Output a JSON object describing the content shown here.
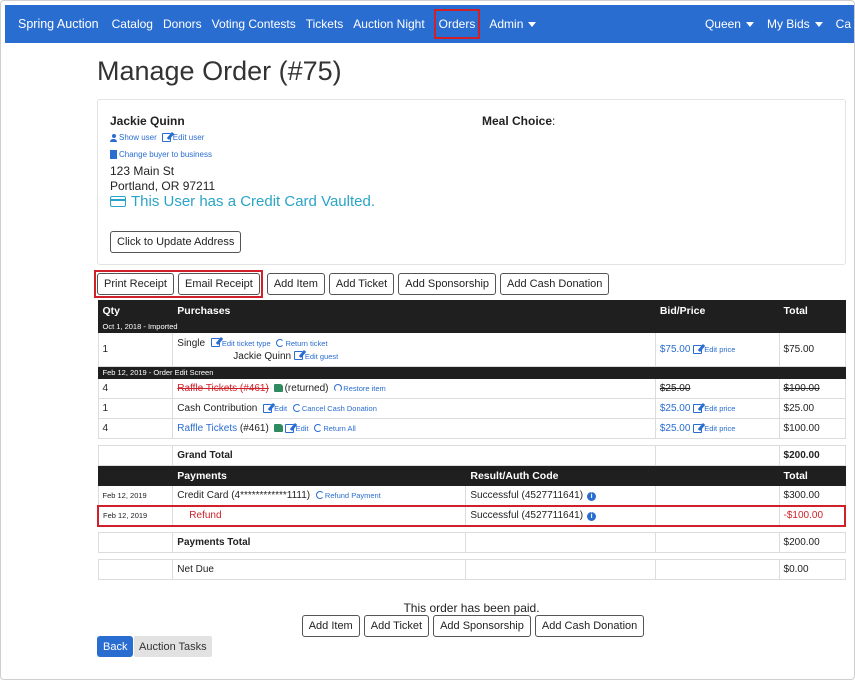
{
  "navbar": {
    "brand": "Spring Auction",
    "items": [
      "Catalog",
      "Donors",
      "Voting Contests",
      "Tickets",
      "Auction Night",
      "Orders",
      "Admin"
    ],
    "right_items": [
      "Queen",
      "My Bids",
      "Ca"
    ]
  },
  "page": {
    "title": "Manage Order (#75)"
  },
  "user": {
    "name": "Jackie Quinn",
    "meal_choice_label": "Meal Choice",
    "show_user": "Show user",
    "edit_user": "Edit user",
    "change_buyer": "Change buyer to business",
    "address_line1": "123 Main St",
    "address_line2": "Portland, OR 97211",
    "credit_card_msg": "This User has a Credit Card Vaulted.",
    "update_address": "Click to Update Address"
  },
  "toolbar": {
    "print_receipt": "Print Receipt",
    "email_receipt": "Email Receipt",
    "add_item": "Add Item",
    "add_ticket": "Add Ticket",
    "add_sponsorship": "Add Sponsorship",
    "add_cash_donation": "Add Cash Donation"
  },
  "table": {
    "headers": {
      "qty": "Qty",
      "purchases": "Purchases",
      "bid_price": "Bid/Price",
      "total": "Total"
    },
    "groups": [
      {
        "label": "Oct 1, 2018 - Imported",
        "rows": [
          {
            "qty": "1",
            "name": "Single",
            "edit_ticket_type": "Edit ticket type",
            "return_ticket": "Return ticket",
            "guest": "Jackie Quinn",
            "edit_guest": "Edit guest",
            "price": "$75.00",
            "edit_price": "Edit price",
            "total": "$75.00"
          }
        ]
      },
      {
        "label": "Feb 12, 2019 - Order Edit Screen",
        "rows": [
          {
            "qty": "4",
            "name": "Raffle Tickets (#461)",
            "status": "(returned)",
            "restore": "Restore item",
            "price": "$25.00",
            "total": "$100.00"
          },
          {
            "qty": "1",
            "name": "Cash Contribution",
            "edit": "Edit",
            "cancel": "Cancel Cash Donation",
            "price": "$25.00",
            "edit_price": "Edit price",
            "total": "$25.00"
          },
          {
            "qty": "4",
            "name": "Raffle Tickets",
            "id": "(#461)",
            "edit": "Edit",
            "return_all": "Return All",
            "price": "$25.00",
            "edit_price": "Edit price",
            "total": "$100.00"
          }
        ]
      }
    ],
    "grand_total_label": "Grand Total",
    "grand_total": "$200.00",
    "payments_headers": {
      "payments": "Payments",
      "result": "Result/Auth Code",
      "total": "Total"
    },
    "payments": [
      {
        "date": "Feb 12, 2019",
        "desc": "Credit Card (4************1111)",
        "refund_link": "Refund Payment",
        "result": "Successful (4527711641)",
        "total": "$300.00"
      },
      {
        "date": "Feb 12, 2019",
        "desc": "Refund",
        "result": "Successful (4527711641)",
        "total": "-$100.00"
      }
    ],
    "payments_total_label": "Payments Total",
    "payments_total": "$200.00",
    "net_due_label": "Net Due",
    "net_due": "$0.00"
  },
  "footer": {
    "paid_msg": "This order has been paid.",
    "add_item": "Add Item",
    "add_ticket": "Add Ticket",
    "add_sponsorship": "Add Sponsorship",
    "add_cash_donation": "Add Cash Donation",
    "back": "Back",
    "auction_tasks": "Auction Tasks"
  },
  "colors": {
    "nav": "#2a6dd1",
    "highlight": "#d0202a",
    "link": "#2a6dd1",
    "cc": "#2aa4c6"
  }
}
